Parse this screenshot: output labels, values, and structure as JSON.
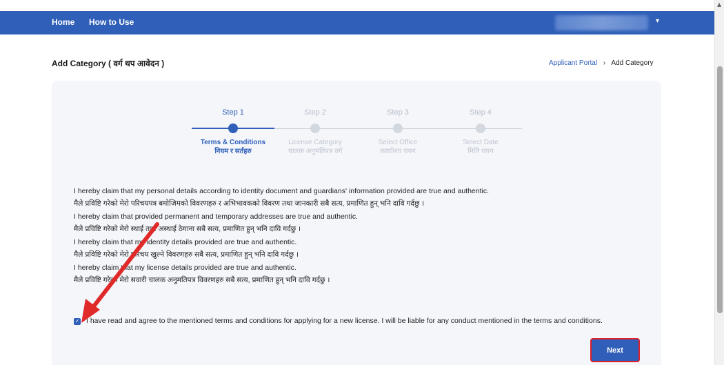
{
  "nav": {
    "items": [
      {
        "label": "Home"
      },
      {
        "label": "How to Use"
      }
    ],
    "user_caret": "▾"
  },
  "page": {
    "title": "Add Category ( वर्ग थप आवेदन )",
    "breadcrumb": {
      "link": "Applicant Portal",
      "separator": "›",
      "current": "Add Category"
    }
  },
  "steps": [
    {
      "label": "Step 1",
      "title_en": "Terms & Conditions",
      "title_np": "नियम र सर्तहरु",
      "active": true
    },
    {
      "label": "Step 2",
      "title_en": "License Category",
      "title_np": "चालक अनुमतिपत्र वर्ग",
      "active": false
    },
    {
      "label": "Step 3",
      "title_en": "Select Office",
      "title_np": "कार्यालय चयन",
      "active": false
    },
    {
      "label": "Step 4",
      "title_en": "Select Date",
      "title_np": "मिति चयन",
      "active": false
    }
  ],
  "terms": [
    {
      "en": "I hereby claim that my personal details according to identity document and guardians' information provided are true and authentic.",
      "np": "मैले प्रविष्टि गरेको मेरो परिचयपत्र बमोजिमको विवरणहरु र अभिभावकको विवरण तथा जानकारी सबै सत्य, प्रमाणित हुन् भनि दावि गर्दछु ।"
    },
    {
      "en": "I hereby claim that provided permanent and temporary addresses are true and authentic.",
      "np": "मैले प्रविष्टि गरेको मेरो स्थाई तथा अस्थाई ठेगाना सबै सत्य, प्रमाणित हुन् भनि दावि गर्दछु ।"
    },
    {
      "en": "I hereby claim that my identity details provided are true and authentic.",
      "np": "मैले प्रविष्टि गरेको मेरो परिचय खुल्ने विवरणहरु सबै सत्य, प्रमाणित हुन् भनि दावि गर्दछु ।"
    },
    {
      "en": "I hereby claim that my license details provided are true and authentic.",
      "np": "मैले प्रविष्टि गरेको मेरो सवारी चालक अनुमतिपत्र विवरणहरु सबै सत्य, प्रमाणित हुन् भनि दावि गर्दछु ।"
    }
  ],
  "agreement": {
    "checked": true,
    "check_glyph": "✓",
    "text": "I have read and agree to the mentioned terms and conditions for applying for a new license. I will be liable for any conduct mentioned in the terms and conditions."
  },
  "buttons": {
    "next_label": "Next"
  },
  "colors": {
    "primary": "#2f5fb8",
    "highlight": "#e0202a",
    "card_bg": "#f4f6fa"
  }
}
